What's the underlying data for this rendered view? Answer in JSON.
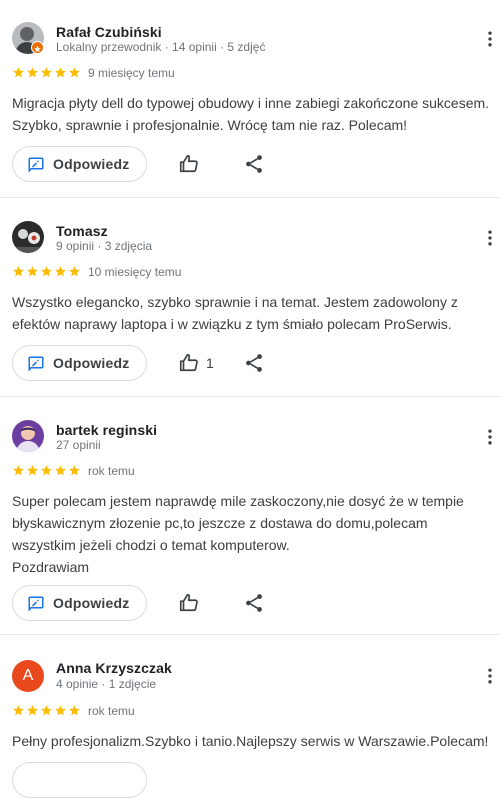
{
  "actions": {
    "reply_label": "Odpowiedz"
  },
  "colors": {
    "star": "#fbbc04",
    "reply_icon": "#1a73e8",
    "guide_badge": "#e8710a",
    "anna_avatar": "#e8491d"
  },
  "reviews": [
    {
      "author": "Rafał Czubiński",
      "meta": "Lokalny przewodnik · 14 opinii · 5 zdjęć",
      "rating": 5,
      "date": "9 miesięcy temu",
      "text": "Migracja płyty dell do typowej obudowy i inne zabiegi zakończone sukcesem. Szybko, sprawnie i profesjonalnie. Wrócę tam nie raz. Polecam!",
      "likes": ""
    },
    {
      "author": "Tomasz",
      "meta": "9 opinii · 3 zdjęcia",
      "rating": 5,
      "date": "10 miesięcy temu",
      "text": "Wszystko elegancko, szybko sprawnie i na temat. Jestem zadowolony z efektów naprawy laptopa i w związku z tym śmiało polecam ProSerwis.",
      "likes": "1"
    },
    {
      "author": "bartek reginski",
      "meta": "27 opinii",
      "rating": 5,
      "date": "rok temu",
      "text": "Super polecam jestem naprawdę mile zaskoczony,nie dosyć że w tempie błyskawicznym złozenie pc,to jeszcze z dostawa do domu,polecam wszystkim jeżeli chodzi o temat komputerow.\nPozdrawiam",
      "likes": ""
    },
    {
      "author": "Anna Krzyszczak",
      "avatar_letter": "A",
      "meta": "4 opinie · 1 zdjęcie",
      "rating": 5,
      "date": "rok temu",
      "text": "Pełny profesjonalizm.Szybko i tanio.Najlepszy serwis w Warszawie.Polecam!",
      "likes": ""
    }
  ]
}
